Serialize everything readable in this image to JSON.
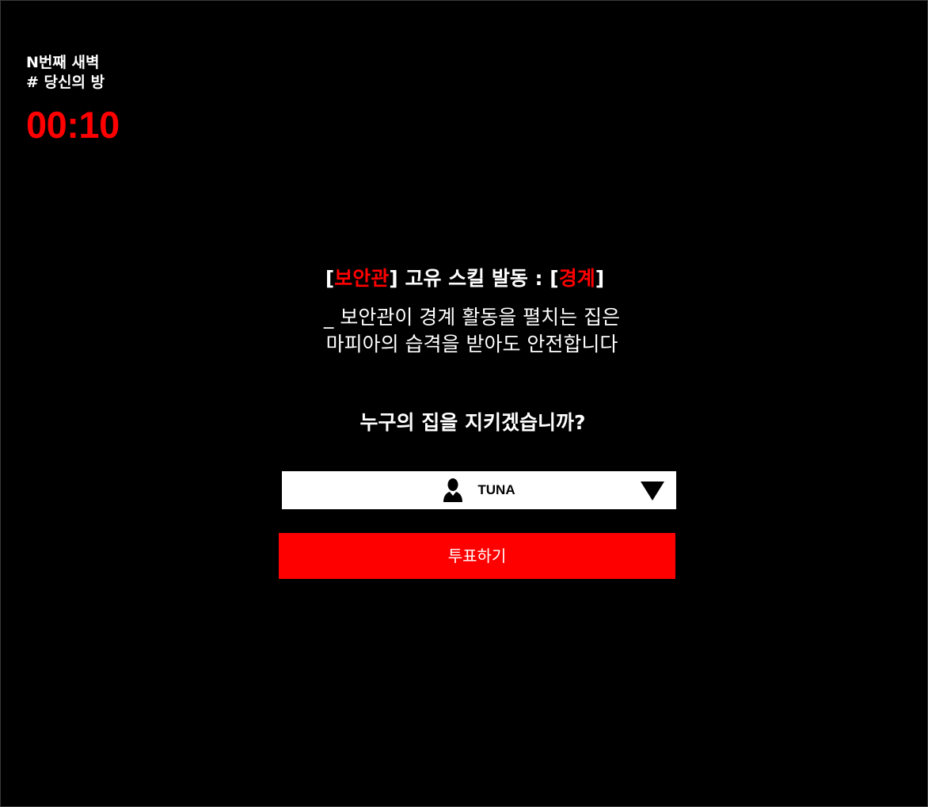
{
  "header": {
    "night_label": "N번째 새벽",
    "room_label": "# 당신의 방",
    "timer": "00:10"
  },
  "skill": {
    "bracket_open_1": "[",
    "role_name": "보안관",
    "bracket_close_1": "]",
    "activation_text": " 고유 스킬 발동 : ",
    "bracket_open_2": "[",
    "skill_name": "경계",
    "bracket_close_2": "]",
    "description_line1": "_ 보안관이 경계 활동을 펼치는 집은",
    "description_line2": "마피아의 습격을 받아도 안전합니다"
  },
  "question": "누구의 집을 지키겠습니까?",
  "target_select": {
    "selected_value": "TUNA",
    "icon": "user-icon",
    "arrow_icon": "triangle-down-icon"
  },
  "vote_button": {
    "label": "투표하기"
  },
  "colors": {
    "background": "#000000",
    "accent": "#ff0000",
    "text": "#ffffff",
    "select_background": "#ffffff"
  }
}
